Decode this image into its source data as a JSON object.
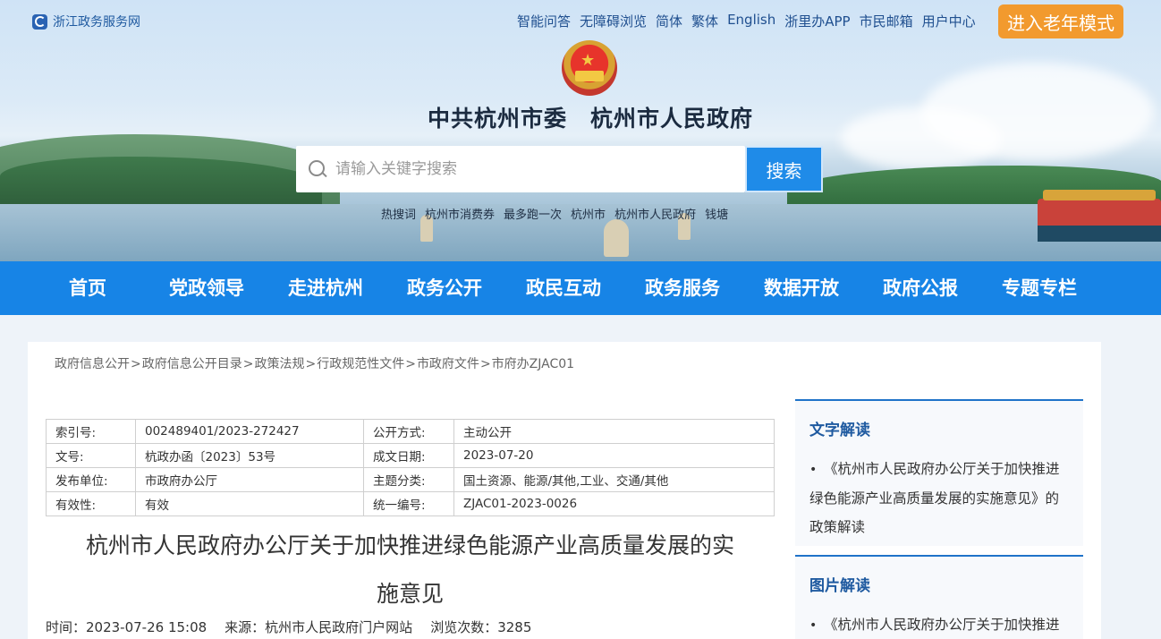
{
  "header": {
    "site_link": "浙江政务服务网",
    "top_links": [
      "智能问答",
      "无障碍浏览",
      "简体",
      "繁体",
      "English",
      "浙里办APP",
      "市民邮箱",
      "用户中心"
    ],
    "elder_mode": "进入老年模式",
    "site_title": "中共杭州市委　杭州市人民政府",
    "search_placeholder": "请输入关键字搜索",
    "search_button": "搜索",
    "hotwords": [
      "热搜词",
      "杭州市消费券",
      "最多跑一次",
      "杭州市",
      "杭州市人民政府",
      "钱塘"
    ]
  },
  "nav": [
    "首页",
    "党政领导",
    "走进杭州",
    "政务公开",
    "政民互动",
    "政务服务",
    "数据开放",
    "政府公报",
    "专题专栏"
  ],
  "breadcrumb": [
    "政府信息公开",
    "政府信息公开目录",
    "政策法规",
    "行政规范性文件",
    "市政府文件",
    "市府办ZJAC01"
  ],
  "breadcrumb_sep": ">",
  "meta_table": [
    [
      "索引号:",
      "002489401/2023-272427",
      "公开方式:",
      "主动公开"
    ],
    [
      "文号:",
      "杭政办函〔2023〕53号",
      "成文日期:",
      "2023-07-20"
    ],
    [
      "发布单位:",
      "市政府办公厅",
      "主题分类:",
      "国土资源、能源/其他,工业、交通/其他"
    ],
    [
      "有效性:",
      "有效",
      "统一编号:",
      "ZJAC01-2023-0026"
    ]
  ],
  "doc": {
    "title_line1": "杭州市人民政府办公厅关于加快推进绿色能源产业高质量发展的实",
    "title_line2": "施意见",
    "time": "时间：2023-07-26 15:08",
    "source": "来源：杭州市人民政府门户网站",
    "views": "浏览次数：3285"
  },
  "sidebar": [
    {
      "heading": "文字解读",
      "item": "《杭州市人民政府办公厅关于加快推进绿色能源产业高质量发展的实施意见》的政策解读"
    },
    {
      "heading": "图片解读",
      "item": "《杭州市人民政府办公厅关于加快推进"
    }
  ],
  "colors": {
    "nav_blue": "#1784e6",
    "elder_orange": "#f29a2e",
    "link_blue": "#1f5aa0"
  }
}
